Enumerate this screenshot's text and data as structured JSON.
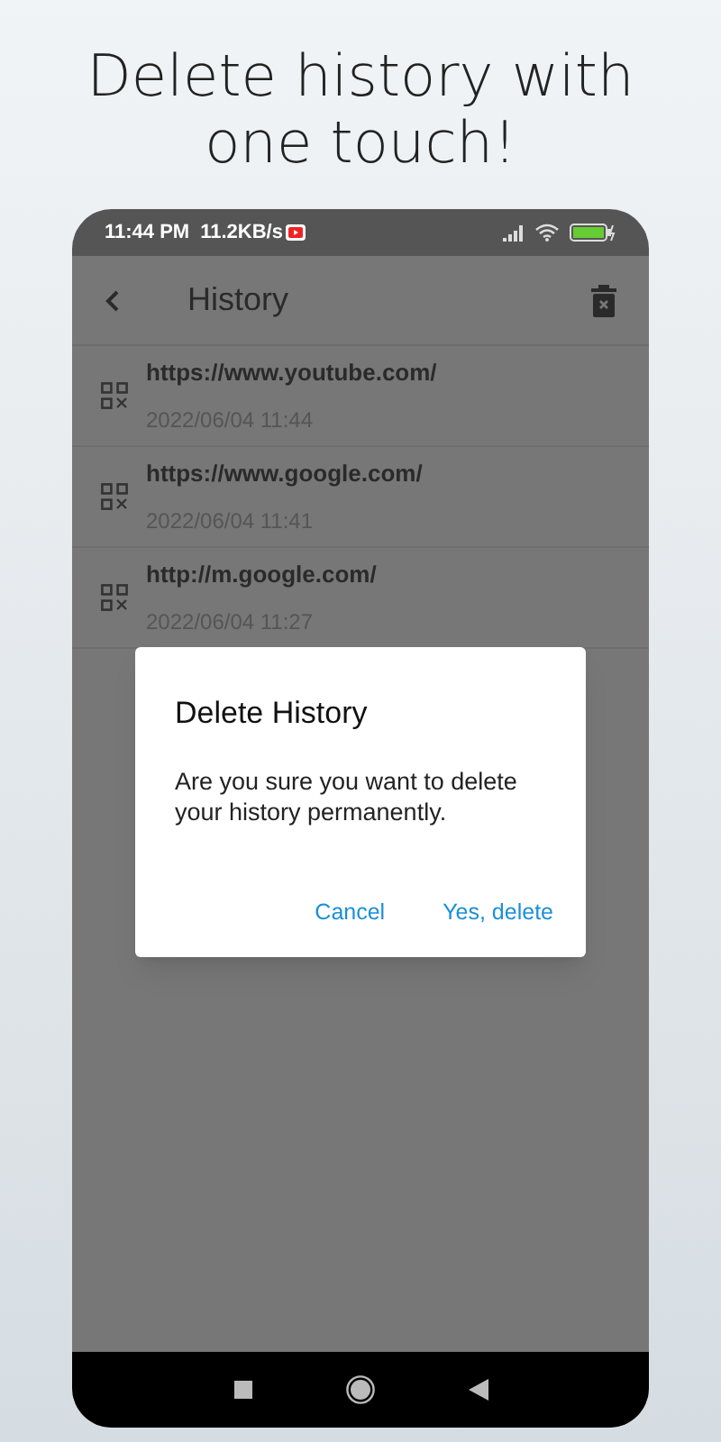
{
  "headline": "Delete history with one touch!",
  "status_bar": {
    "time": "11:44 PM",
    "speed": "11.2KB/s"
  },
  "app_bar": {
    "title": "History"
  },
  "history": [
    {
      "url": "https://www.youtube.com/",
      "date": "2022/06/04 11:44"
    },
    {
      "url": "https://www.google.com/",
      "date": "2022/06/04 11:41"
    },
    {
      "url": "http://m.google.com/",
      "date": "2022/06/04 11:27"
    }
  ],
  "dialog": {
    "title": "Delete History",
    "message": "Are you sure you want to delete your history permanently.",
    "buttons": [
      "Cancel",
      "Yes, delete"
    ]
  }
}
